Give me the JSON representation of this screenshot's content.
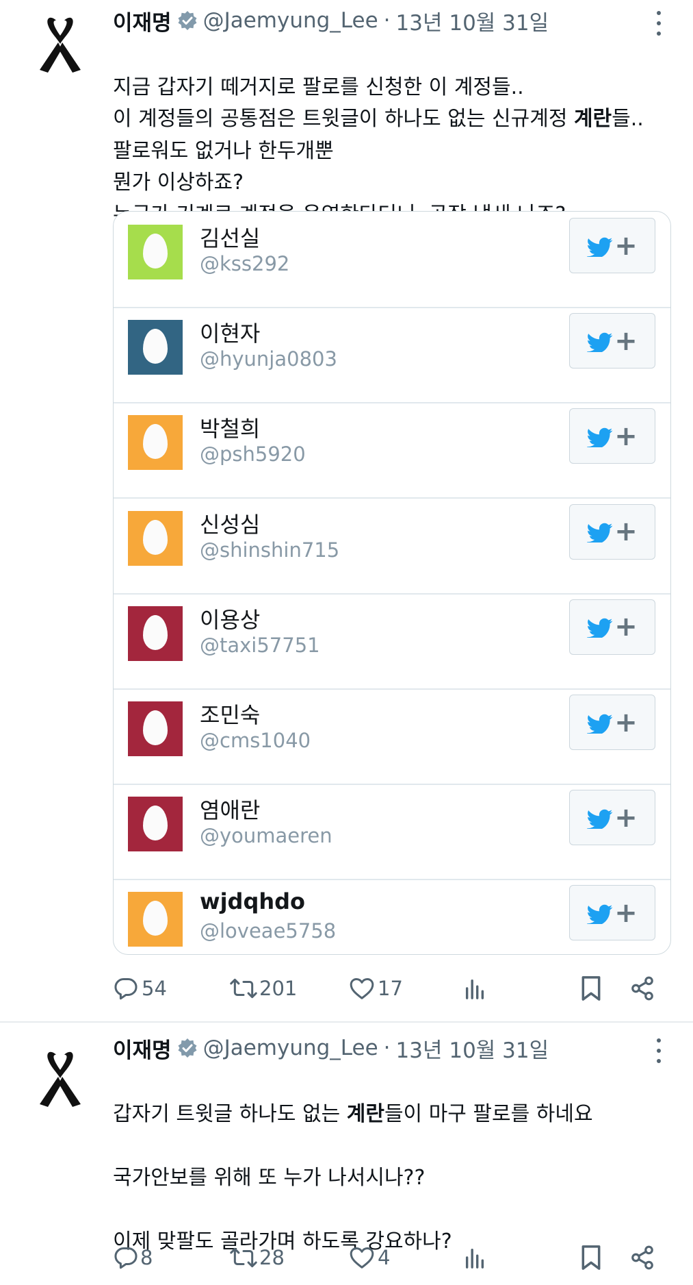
{
  "tweets": [
    {
      "author": "이재명",
      "handle": "@Jaemyung_Lee",
      "separator": "·",
      "date": "13년 10월 31일",
      "text_parts": [
        {
          "t": "지금 갑자기 떼거지로 팔로를 신청한 이 계정들..\n이 계정들의 공통점은 트윗글이 하나도 없는 신규계정 "
        },
        {
          "b": "계란"
        },
        {
          "t": "들..\n팔로워도 없거나 한두개뿐\n뭔가 이상하죠?\n누군가 기계로 계정을 운영한다더니..공작 냄새 나죠?"
        }
      ],
      "replies": "54",
      "retweets": "201",
      "likes": "17"
    },
    {
      "author": "이재명",
      "handle": "@Jaemyung_Lee",
      "separator": "·",
      "date": "13년 10월 31일",
      "text_parts": [
        {
          "t": "갑자기 트윗글 하나도 없는 "
        },
        {
          "b": "계란"
        },
        {
          "t": "들이 마구 팔로를 하네요\n\n국가안보를 위해 또 누가 나서시나??\n\n이제 맞팔도 골라가며 하도록 강요하나?"
        }
      ],
      "replies": "8",
      "retweets": "28",
      "likes": "4"
    }
  ],
  "accounts": [
    {
      "name": "김선실",
      "handle": "@kss292",
      "color": "#a6dd4c"
    },
    {
      "name": "이현자",
      "handle": "@hyunja0803",
      "color": "#326583"
    },
    {
      "name": "박철희",
      "handle": "@psh5920",
      "color": "#f7a83a"
    },
    {
      "name": "신성심",
      "handle": "@shinshin715",
      "color": "#f7a83a"
    },
    {
      "name": "이용상",
      "handle": "@taxi57751",
      "color": "#a3263d"
    },
    {
      "name": "조민숙",
      "handle": "@cms1040",
      "color": "#a3263d"
    },
    {
      "name": "염애란",
      "handle": "@youmaeren",
      "color": "#a3263d"
    },
    {
      "name": "wjdqhdo",
      "handle": "@loveae5758",
      "color": "#f7a83a"
    }
  ],
  "icons": {
    "ribbon": "black-ribbon-icon",
    "verified": "verified-badge-icon",
    "more": "more-options-icon",
    "reply": "reply-icon",
    "retweet": "retweet-icon",
    "like": "heart-icon",
    "views": "views-chart-icon",
    "bookmark": "bookmark-icon",
    "share": "share-icon",
    "twitter": "twitter-bird-icon"
  },
  "colors": {
    "twitter_blue": "#1da1f2",
    "secondary_text": "#536471",
    "handle_text": "#8899a6"
  }
}
